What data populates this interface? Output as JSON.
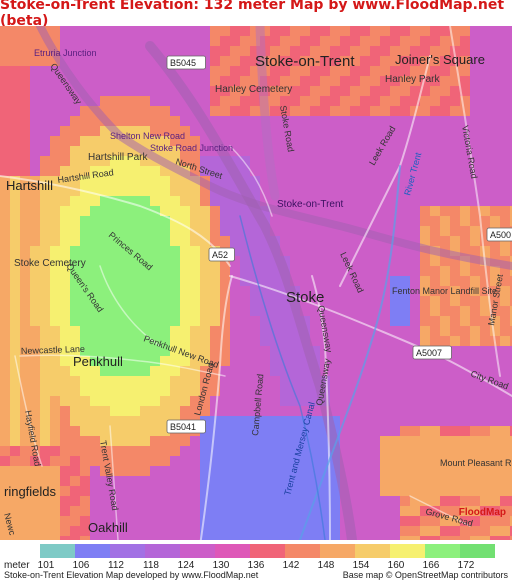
{
  "title": "Stoke-on-Trent Elevation: 132 meter Map by www.FloodMap.net (beta)",
  "legend": {
    "unit": "meter",
    "values": [
      "101",
      "106",
      "112",
      "118",
      "124",
      "130",
      "136",
      "142",
      "148",
      "154",
      "160",
      "166",
      "172"
    ],
    "colors": [
      "#7ecac6",
      "#7e7ef4",
      "#a271e4",
      "#b466d8",
      "#cc5ec8",
      "#de58b8",
      "#f06478",
      "#f48868",
      "#f6a866",
      "#f6cc6a",
      "#f6f070",
      "#8cf07c",
      "#72e072"
    ],
    "credit_left": "Stoke-on-Trent Elevation Map developed by www.FloodMap.net",
    "credit_right": "Base map © OpenStreetMap contributors"
  },
  "watermark": "FloodMap",
  "places": {
    "stoke_on_trent": "Stoke-on-Trent",
    "joiners_square": "Joiner's Square",
    "hanley_park": "Hanley Park",
    "hanley_cemetery": "Hanley Cemetery",
    "hartshill": "Hartshill",
    "hartshill_park": "Hartshill Park",
    "stoke_cemetery": "Stoke Cemetery",
    "penkhull": "Penkhull",
    "stoke": "Stoke",
    "fenton_manor": "Fenton Manor Landfill Site",
    "mount_pleasant": "Mount Pleasant Recreation",
    "springfields": "ringfields",
    "oakhill": "Oakhill",
    "stoke_on_trent_station": "Stoke-on-Trent",
    "etruria_junction": "Etruria Junction",
    "shelton_new_road": "Shelton New Road",
    "stoke_road_junction": "Stoke Road Junction"
  },
  "roads": {
    "b5045": "B5045",
    "a52": "A52",
    "a500": "A500",
    "a5007": "A5007",
    "b5041": "B5041",
    "queensway_n": "Queensway",
    "north_street": "North Street",
    "hartshill_road": "Hartshill Road",
    "princes_road": "Princes Road",
    "queens_road": "Queen's Road",
    "newcastle_lane": "Newcastle Lane",
    "penkhull_new_road": "Penkhull New Road",
    "london_road": "London Road",
    "stoke_road": "Stoke Road",
    "leek_road": "Leek Road",
    "leek_road2": "Leek Road",
    "victoria_road": "Victoria Road",
    "river_trent": "River Trent",
    "city_road": "City Road",
    "manor_street": "Manor Street",
    "queensway_s": "Queensway",
    "queensway_s2": "Queensway",
    "campbell_road": "Campbell Road",
    "trent_valley_road": "Trent Valley Road",
    "hayfield_road": "Hayfield Road",
    "grove_road": "Grove Road",
    "trent_and_mersey": "Trent and Mersey Canal",
    "newcastle": "Newc"
  }
}
